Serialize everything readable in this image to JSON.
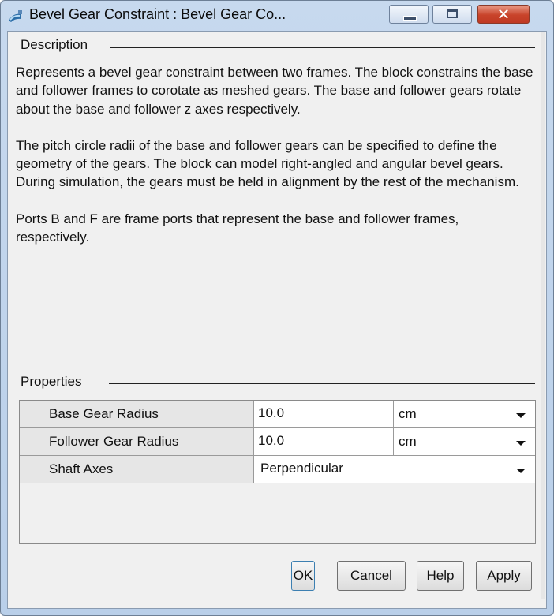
{
  "window": {
    "title": "Bevel Gear Constraint : Bevel Gear Co...",
    "close_glyph": "✕"
  },
  "description": {
    "label": "Description",
    "paragraphs": [
      "Represents a bevel gear constraint between two frames. The block constrains the base and follower frames to corotate as meshed gears. The base and follower gears rotate about the base and follower z axes respectively.",
      "The pitch circle radii of the base and follower gears can be specified to define the geometry of the gears. The block can model right-angled and angular bevel gears. During simulation, the gears must be held in alignment by the rest of the mechanism.",
      "Ports B and F are frame ports that represent the base and follower frames, respectively."
    ]
  },
  "properties": {
    "label": "Properties",
    "rows": [
      {
        "name": "Base Gear Radius",
        "value": "10.0",
        "unit": "cm"
      },
      {
        "name": "Follower Gear Radius",
        "value": "10.0",
        "unit": "cm"
      },
      {
        "name": "Shaft Axes",
        "value": "Perpendicular"
      }
    ]
  },
  "buttons": {
    "ok": "OK",
    "cancel": "Cancel",
    "help": "Help",
    "apply": "Apply"
  },
  "icons": {
    "app": "simulink-block-icon",
    "minimize": "minimize-icon",
    "maximize": "maximize-icon",
    "close": "close-icon",
    "dropdown": "chevron-down-icon"
  },
  "colors": {
    "title_bar": "#c7d9ee",
    "close_button": "#c8432a",
    "client_background": "#f0f0f0",
    "property_name_cell": "#e6e6e6"
  }
}
